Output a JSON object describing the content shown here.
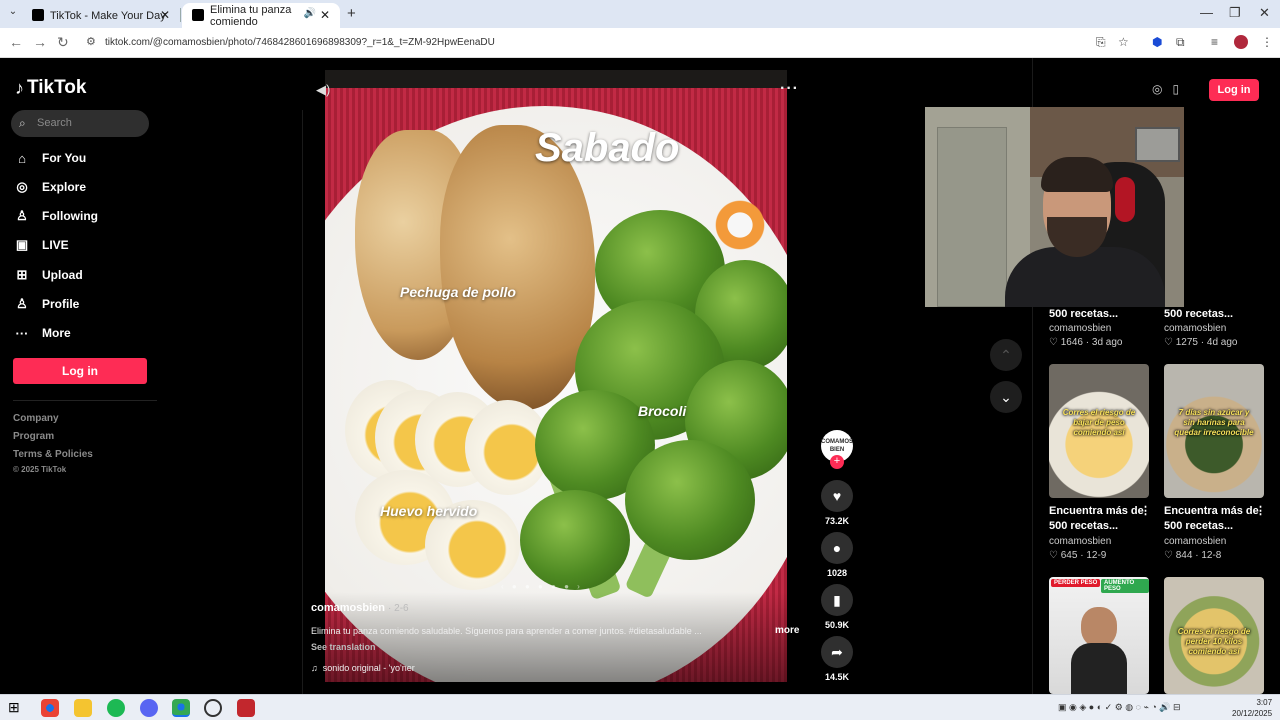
{
  "browser": {
    "tabs": [
      {
        "title": "TikTok - Make Your Day"
      },
      {
        "title": "Elimina tu panza comiendo"
      }
    ],
    "url": "tiktok.com/@comamosbien/photo/7468428601696898309?_r=1&_t=ZM-92HpwEenaDU"
  },
  "sidebar": {
    "logo": "TikTok",
    "search_placeholder": "Search",
    "nav": [
      {
        "label": "For You",
        "icon": "home-icon"
      },
      {
        "label": "Explore",
        "icon": "compass-icon"
      },
      {
        "label": "Following",
        "icon": "user-icon"
      },
      {
        "label": "LIVE",
        "icon": "live-icon"
      },
      {
        "label": "Upload",
        "icon": "upload-icon"
      },
      {
        "label": "Profile",
        "icon": "profile-icon"
      },
      {
        "label": "More",
        "icon": "more-icon"
      }
    ],
    "login": "Log in",
    "footer": [
      "Company",
      "Program",
      "Terms & Policies"
    ],
    "copyright": "© 2025 TikTok"
  },
  "post": {
    "overlay_title": "Sabado",
    "overlay_labels": [
      "Pechuga de pollo",
      "Brocoli",
      "Huevo hervido"
    ],
    "author": "comamosbien",
    "date": "· 2-6",
    "caption": "Elimina tu panza comiendo saludable. Síguenos para aprender a comer juntos. #dietasaludable ...",
    "more": "more",
    "see_translation": "See translation",
    "sound": "sonido original - 'yo'ner",
    "creator_avatar_text": "COMAMOS BIEN",
    "likes": "73.2K",
    "comments": "1028",
    "saves": "50.9K",
    "shares": "14.5K"
  },
  "header": {
    "login": "Log in"
  },
  "related": [
    {
      "title": "500 recetas...",
      "author": "comamosbien",
      "likes": "1646",
      "date": "3d ago"
    },
    {
      "title": "500 recetas...",
      "author": "comamosbien",
      "likes": "1275",
      "date": "4d ago"
    },
    {
      "title": "Encuentra más de 500 recetas...",
      "author": "comamosbien",
      "likes": "645",
      "date": "12-9",
      "thumb_text": "Corres el riesgo de bajar de peso comiendo así"
    },
    {
      "title": "Encuentra más de 500 recetas...",
      "author": "comamosbien",
      "likes": "844",
      "date": "12-8",
      "thumb_text": "7 días sin azúcar y sin harinas para quedar irreconocible"
    },
    {
      "thumb_tags": [
        "PERDER PESO",
        "AUMENTO PESO"
      ]
    },
    {
      "thumb_text": "Corres el riesgo de perder 10 kilos comiendo así"
    }
  ],
  "taskbar": {
    "time": "3:07",
    "date": "20/12/2025"
  },
  "colors": {
    "accent": "#fe2c55",
    "background": "#000000"
  }
}
